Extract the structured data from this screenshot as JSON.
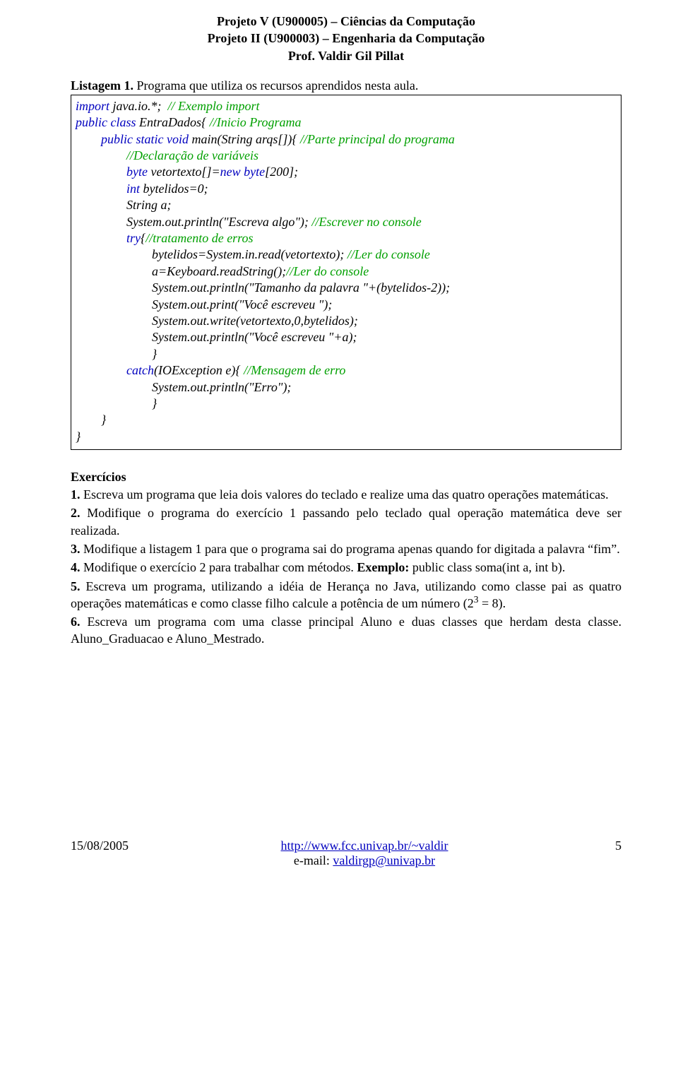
{
  "header": {
    "line1": "Projeto V (U900005) – Ciências da Computação",
    "line2": "Projeto II (U900003) – Engenharia da Computação",
    "line3": "Prof. Valdir Gil Pillat"
  },
  "listing": {
    "caption_bold": "Listagem 1.",
    "caption_rest": " Programa que utiliza os recursos aprendidos nesta aula.",
    "code": {
      "l1a": "import",
      "l1b": " java.io.*;  ",
      "l1c": "// Exemplo import",
      "l2a": "public class",
      "l2b": " EntraDados{ ",
      "l2c": "//Inicio Programa",
      "l3a": "public static void",
      "l3b": " main(String arqs[]){ ",
      "l3c": "//Parte principal do programa",
      "l4": "//Declaração de variáveis",
      "l5a": "byte",
      "l5b": " vetortexto[]=",
      "l5c": "new byte",
      "l5d": "[200];",
      "l6a": "int",
      "l6b": " bytelidos=0;",
      "l7": "String a;",
      "l8a": "System.out.println(\"Escreva algo\"); ",
      "l8b": "//Escrever no console",
      "l9a": "try",
      "l9b": "{",
      "l9c": "//tratamento de erros",
      "l10a": "bytelidos=System.in.read(vetortexto); ",
      "l10b": "//Ler do console",
      "l11a": "a=Keyboard.readString();",
      "l11b": "//Ler do console",
      "l12": "System.out.println(\"Tamanho da palavra \"+(bytelidos-2));",
      "l13": "System.out.print(\"Você escreveu \");",
      "l14": "System.out.write(vetortexto,0,bytelidos);",
      "l15": "System.out.println(\"Você escreveu \"+a);",
      "l16": "}",
      "l17a": "catch",
      "l17b": "(IOException e){ ",
      "l17c": "//Mensagem de erro",
      "l18": "System.out.println(\"Erro\");",
      "l19": "}",
      "l20": "}",
      "l21": "}"
    }
  },
  "exercises": {
    "title": "Exercícios",
    "items": {
      "e1b": "1.",
      "e1": " Escreva um programa que leia dois valores do teclado e realize uma das quatro operações matemáticas.",
      "e2b": "2.",
      "e2": " Modifique o programa do exercício 1 passando pelo teclado qual operação matemática deve ser realizada.",
      "e3b": "3.",
      "e3": " Modifique a listagem 1 para que o programa sai do programa apenas quando for digitada a palavra “fim”.",
      "e4b": "4.",
      "e4a": " Modifique o exercício 2 para trabalhar com métodos. ",
      "e4c": "Exemplo:",
      "e4d": " public class soma(int a, int b).",
      "e5b": "5.",
      "e5a": " Escreva um programa, utilizando a idéia de Herança no Java,  utilizando como classe pai as quatro operações matemáticas e como classe filho calcule a potência de um número (2",
      "e5sup": "3",
      "e5c": " = 8).",
      "e6b": "6.",
      "e6": " Escreva um programa com uma classe principal Aluno e duas classes que herdam desta classe. Aluno_Graduacao e Aluno_Mestrado."
    }
  },
  "footer": {
    "date": "15/08/2005",
    "url": "http://www.fcc.univap.br/~valdir",
    "email_label": "e-mail: ",
    "email": "valdirgp@univap.br",
    "page_number": "5"
  }
}
